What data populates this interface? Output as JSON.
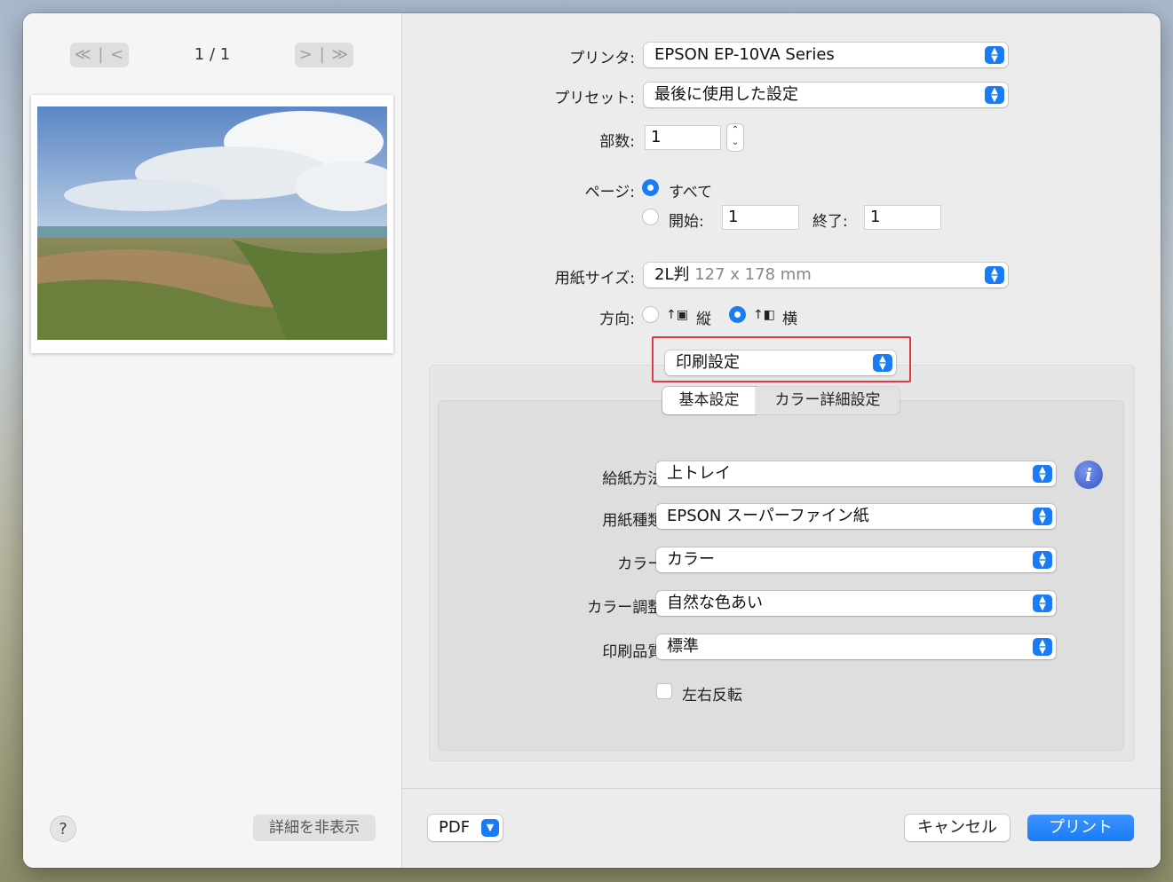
{
  "preview": {
    "first_label": "≪ | <",
    "next_label": "> | ≫",
    "page_counter": "1 / 1",
    "help_label": "?",
    "hide_details_label": "詳細を非表示"
  },
  "printer": {
    "label": "プリンタ:",
    "value": "EPSON EP-10VA Series"
  },
  "preset": {
    "label": "プリセット:",
    "value": "最後に使用した設定"
  },
  "copies": {
    "label": "部数:",
    "value": "1"
  },
  "pages": {
    "label": "ページ:",
    "all_label": "すべて",
    "from_label": "開始:",
    "from_value": "1",
    "to_label": "終了:",
    "to_value": "1"
  },
  "paper_size": {
    "label": "用紙サイズ:",
    "value": "2L判",
    "value_detail": "127 x 178 mm"
  },
  "orientation": {
    "label": "方向:",
    "portrait_label": "縦",
    "landscape_label": "横"
  },
  "section_popup": {
    "value": "印刷設定"
  },
  "tabs": {
    "basic": "基本設定",
    "color_detail": "カラー詳細設定"
  },
  "feed_method": {
    "label": "給紙方法:",
    "value": "上トレイ"
  },
  "paper_type": {
    "label": "用紙種類:",
    "value": "EPSON スーパーファイン紙"
  },
  "color": {
    "label": "カラー:",
    "value": "カラー"
  },
  "color_adjust": {
    "label": "カラー調整:",
    "value": "自然な色あい"
  },
  "print_quality": {
    "label": "印刷品質:",
    "value": "標準"
  },
  "mirror": {
    "label": "左右反転"
  },
  "footer": {
    "pdf_label": "PDF",
    "cancel_label": "キャンセル",
    "print_label": "プリント"
  },
  "colors": {
    "accent": "#1a7cf5",
    "highlight": "#e03a3a"
  }
}
